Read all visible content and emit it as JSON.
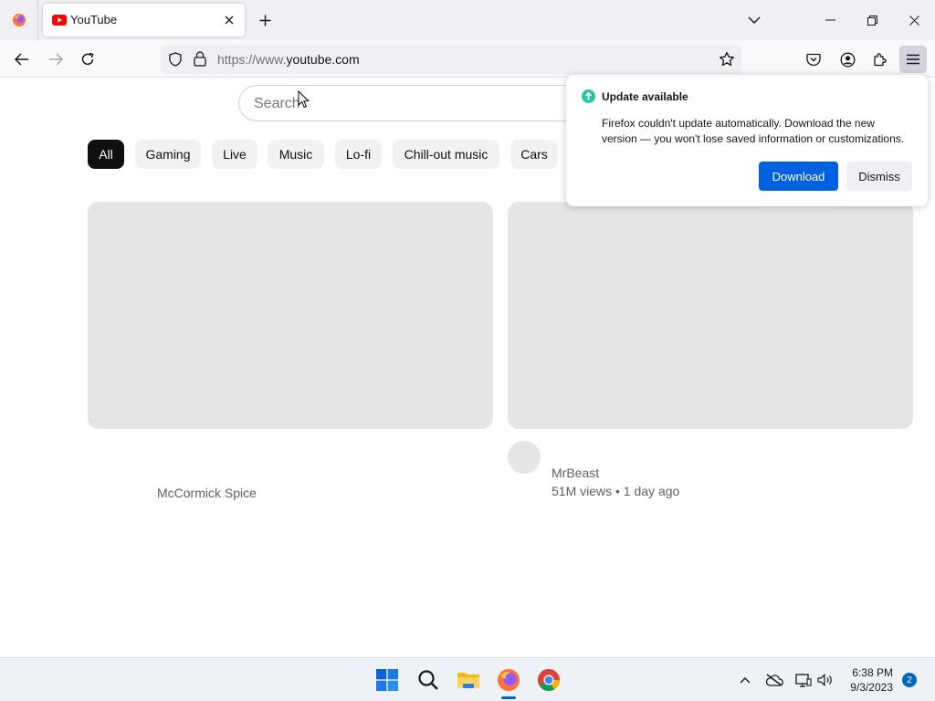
{
  "browser": {
    "tab": {
      "title": "YouTube"
    },
    "url": {
      "prefix": "https://www.",
      "domain": "youtube.com"
    }
  },
  "youtube": {
    "search": {
      "placeholder": "Search"
    },
    "chips": [
      "All",
      "Gaming",
      "Live",
      "Music",
      "Lo-fi",
      "Chill-out music",
      "Cars"
    ],
    "videos": [
      {
        "channel": "McCormick Spice"
      },
      {
        "channel": "MrBeast",
        "stats": "51M views • 1 day ago"
      }
    ]
  },
  "update_popup": {
    "title": "Update available",
    "body": "Firefox couldn't update automatically. Download the new version — you won't lose saved information or customizations.",
    "download_label": "Download",
    "dismiss_label": "Dismiss",
    "accent": "#0061e0",
    "status_color": "#2ac3a2"
  },
  "taskbar": {
    "time": "6:38 PM",
    "date": "9/3/2023",
    "notification_count": "2",
    "icons": [
      "windows-start-icon",
      "search-icon",
      "file-explorer-icon",
      "firefox-icon",
      "chrome-icon"
    ]
  },
  "colors": {
    "youtube_red": "#ff0000",
    "accent_blue": "#0061e0"
  }
}
